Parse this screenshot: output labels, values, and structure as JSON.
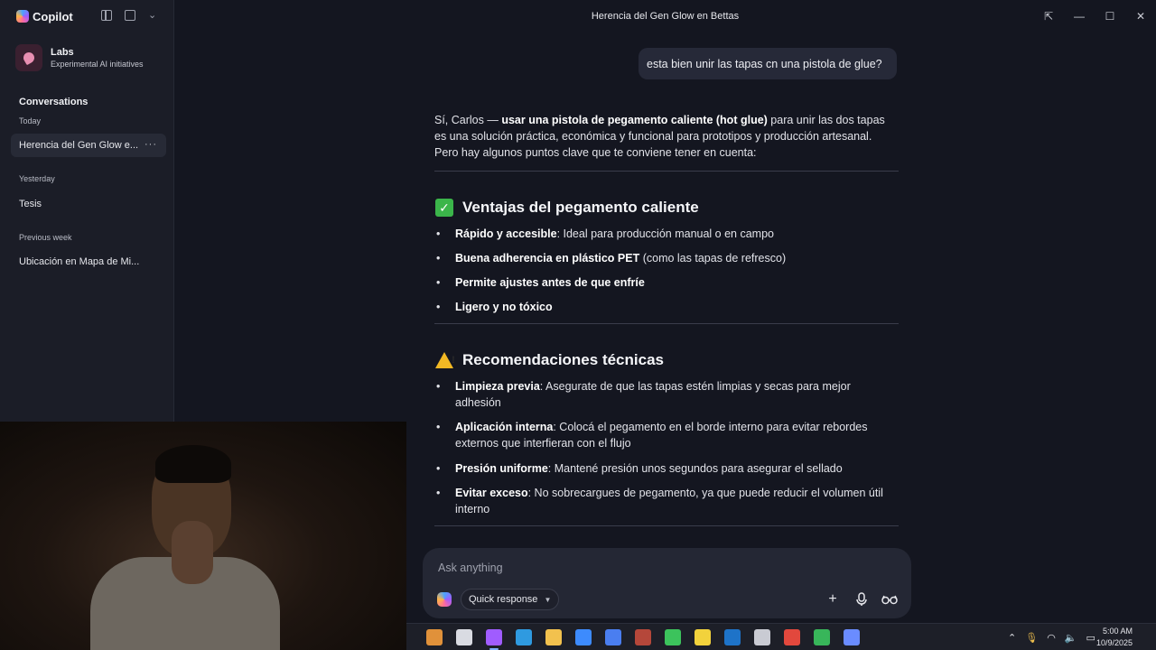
{
  "app": {
    "name": "Copilot",
    "window_title": "Herencia del Gen Glow en Bettas"
  },
  "sidebar": {
    "labs_title": "Labs",
    "labs_subtitle": "Experimental AI initiatives",
    "conversations_title": "Conversations",
    "groups": [
      {
        "label": "Today",
        "items": [
          {
            "label": "Herencia del Gen Glow e...",
            "active": true
          }
        ]
      },
      {
        "label": "Yesterday",
        "items": [
          {
            "label": "Tesis",
            "active": false
          }
        ]
      },
      {
        "label": "Previous week",
        "items": [
          {
            "label": "Ubicación en Mapa de Mi...",
            "active": false
          }
        ]
      }
    ],
    "more_glyph": "···"
  },
  "chat": {
    "user_message": "esta bien unir las tapas cn una pistola de glue?",
    "intro_prefix": "Sí, Carlos — ",
    "intro_bold": "usar una pistola de pegamento caliente (hot glue)",
    "intro_rest": " para unir las dos tapas es una solución práctica, económica y funcional para prototipos y producción artesanal. Pero hay algunos puntos clave que te conviene tener en cuenta:",
    "section1": {
      "title": "Ventajas del pegamento caliente",
      "icon": "check-mark-emoji",
      "items": [
        {
          "bold": "Rápido y accesible",
          "rest": ": Ideal para producción manual o en campo"
        },
        {
          "bold": "Buena adherencia en plástico PET",
          "rest": " (como las tapas de refresco)"
        },
        {
          "bold": "Permite ajustes antes de que enfríe",
          "rest": ""
        },
        {
          "bold": "Ligero y no tóxico",
          "rest": ""
        }
      ]
    },
    "section2": {
      "title": "Recomendaciones técnicas",
      "icon": "warning-emoji",
      "items": [
        {
          "bold": "Limpieza previa",
          "rest": ": Asegurate de que las tapas estén limpias y secas para mejor adhesión"
        },
        {
          "bold": "Aplicación interna",
          "rest": ": Colocá el pegamento en el borde interno para evitar rebordes externos que interfieran con el flujo"
        },
        {
          "bold": "Presión uniforme",
          "rest": ": Mantené presión unos segundos para asegurar el sellado"
        },
        {
          "bold": "Evitar exceso",
          "rest": ": No sobrecargues de pegamento, ya que puede reducir el volumen útil interno"
        }
      ]
    }
  },
  "composer": {
    "placeholder": "Ask anything",
    "mode_label": "Quick response"
  },
  "taskbar": {
    "time": "5:00 AM",
    "date": "10/9/2025",
    "apps": [
      {
        "name": "widgets",
        "color": "#e0913a"
      },
      {
        "name": "task-view",
        "color": "#d9dbe2"
      },
      {
        "name": "copilot",
        "color": "#a05cff"
      },
      {
        "name": "edge",
        "color": "#2f9ae0"
      },
      {
        "name": "file-explorer",
        "color": "#f2c14e"
      },
      {
        "name": "store",
        "color": "#3d8bfd"
      },
      {
        "name": "docs",
        "color": "#4a7ef0"
      },
      {
        "name": "winrar",
        "color": "#b5473a"
      },
      {
        "name": "stocks",
        "color": "#3cc35c"
      },
      {
        "name": "exness",
        "color": "#f2d23c"
      },
      {
        "name": "outlook",
        "color": "#1e73c8"
      },
      {
        "name": "settings",
        "color": "#c9cbd3"
      },
      {
        "name": "chrome",
        "color": "#e2483d"
      },
      {
        "name": "play",
        "color": "#38b65a"
      },
      {
        "name": "copilot-pro",
        "color": "#6a8cff"
      }
    ]
  },
  "colors": {
    "background": "#141620",
    "sidebar": "#1b1d27",
    "bubble": "#262938",
    "accent": "#7fb0ff"
  }
}
